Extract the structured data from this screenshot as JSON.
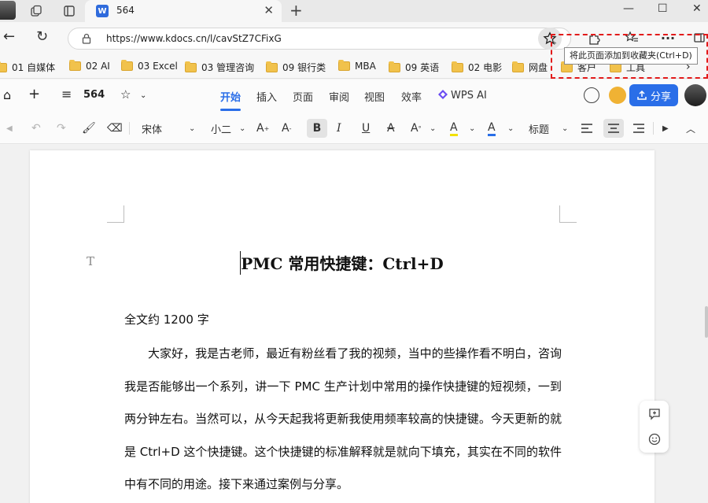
{
  "browser": {
    "tab": {
      "favicon": "W",
      "title": "564"
    },
    "address": {
      "url": "https://www.kdocs.cn/l/cavStZ7CFixG"
    },
    "tooltip": "将此页面添加到收藏夹(Ctrl+D)",
    "highlight_color": "#e21b1b"
  },
  "bookmarks": [
    "01 自媒体",
    "02 AI",
    "03 Excel",
    "03 管理咨询",
    "09 银行类",
    "MBA",
    "09 英语",
    "02 电影",
    "网盘",
    "客户",
    "工具"
  ],
  "wps": {
    "doc_name": "564",
    "menus": [
      "开始",
      "插入",
      "页面",
      "审阅",
      "视图",
      "效率",
      "WPS AI"
    ],
    "active_menu": "开始",
    "share_label": "分享",
    "accent": "#2a6ee8"
  },
  "format": {
    "font_family": "宋体",
    "font_size": "小二",
    "style": "标题",
    "bold": "B",
    "italic": "I",
    "underline": "U",
    "strike": "A",
    "grow": "A",
    "shrink": "A",
    "fx": "A",
    "highlight": "A",
    "color": "A"
  },
  "doc": {
    "title": "PMC 常用快捷键：Ctrl+D",
    "meta": "全文约 1200 字",
    "body": "大家好，我是古老师，最近有粉丝看了我的视频，当中的些操作看不明白，咨询我是否能够出一个系列，讲一下 PMC 生产计划中常用的操作快捷键的短视频，一到两分钟左右。当然可以，从今天起我将更新我使用频率较高的快捷键。今天更新的就是 Ctrl+D 这个快捷键。这个快捷键的标准解释就是就向下填充，其实在不同的软件中有不同的用途。接下来通过案例与分享。"
  }
}
